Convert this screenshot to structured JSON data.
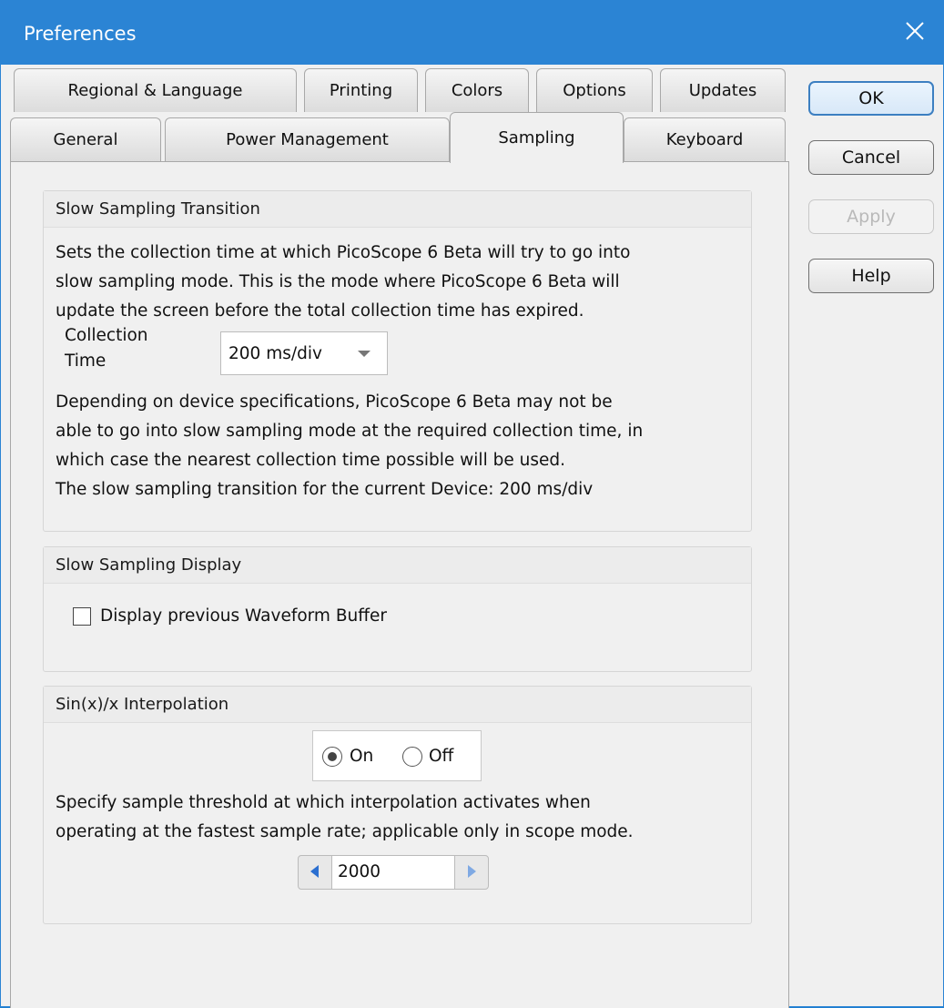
{
  "window": {
    "title": "Preferences"
  },
  "tabs": {
    "row1": [
      "Regional & Language",
      "Printing",
      "Colors",
      "Options",
      "Updates"
    ],
    "row2": [
      "General",
      "Power Management",
      "Sampling",
      "Keyboard"
    ],
    "selected": "Sampling"
  },
  "slow_transition": {
    "title": "Slow Sampling Transition",
    "desc_lines": [
      "Sets the collection time at which PicoScope 6 Beta will try to go into",
      "slow sampling mode. This is the mode where PicoScope 6 Beta will",
      "update the screen before the total collection time has expired."
    ],
    "collection_label_1": "Collection",
    "collection_label_2": "Time",
    "collection_value": "200 ms/div",
    "note_lines": [
      "Depending on device specifications, PicoScope 6 Beta may not be",
      "able to go into slow sampling mode at the required collection time, in",
      "which case the nearest collection time possible will be used.",
      "The slow sampling transition for the current Device: 200 ms/div"
    ]
  },
  "slow_display": {
    "title": "Slow Sampling Display",
    "checkbox_label": "Display previous Waveform Buffer",
    "checked": false
  },
  "interpolation": {
    "title": "Sin(x)/x Interpolation",
    "on_label": "On",
    "off_label": "Off",
    "selected": "On",
    "desc_lines": [
      "Specify sample threshold at which interpolation activates when",
      "operating at the fastest sample rate; applicable only in scope mode."
    ],
    "threshold": "2000"
  },
  "buttons": {
    "ok": "OK",
    "cancel": "Cancel",
    "apply": "Apply",
    "help": "Help"
  },
  "colors": {
    "titlebar": "#2b84d4",
    "default_button_border": "#3c7fc1",
    "spin_arrow": "#2b6fd0"
  },
  "icons": {
    "close": "close-icon",
    "dropdown": "chevron-down-icon",
    "spin_left": "arrow-left-icon",
    "spin_right": "arrow-right-icon"
  }
}
